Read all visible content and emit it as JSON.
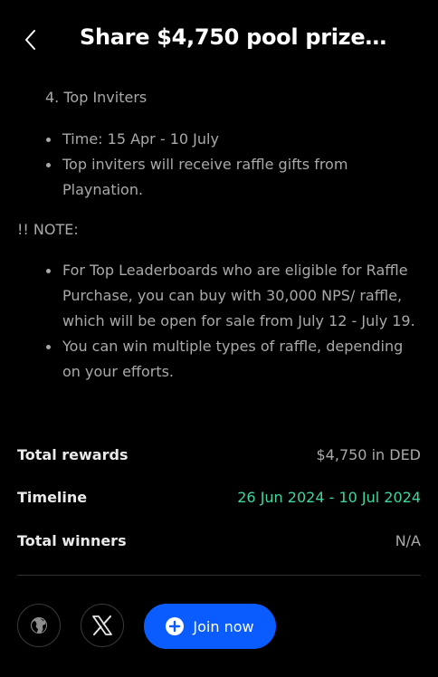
{
  "header": {
    "title": "Share $4,750 pool prize…",
    "back_icon": "chevron-left-icon"
  },
  "content": {
    "list_heading": "4. Top Inviters",
    "inviter_bullets": [
      "Time: 15 Apr - 10 July",
      "Top inviters will receive raffle gifts from Playnation."
    ],
    "note_label": "!! NOTE:",
    "note_bullets": [
      "For Top Leaderboards who are eligible for Raffle Purchase, you can buy with 30,000 NPS/ raffle, which will be open for sale from July 12 - July 19.",
      "You can win multiple types of raffle, depending on your efforts."
    ]
  },
  "stats": [
    {
      "label": "Total rewards",
      "value": "$4,750 in DED"
    },
    {
      "label": "Timeline",
      "value": "26 Jun 2024 - 10 Jul 2024"
    },
    {
      "label": "Total winners",
      "value": "N/A"
    }
  ],
  "colors": {
    "accent": "#0a5cff",
    "timeline": "#3dd6a0",
    "muted": "#a9a9a9"
  },
  "actions": {
    "website_icon": "globe-icon",
    "x_icon": "x-logo-icon",
    "join_icon": "plus-circle-icon",
    "join_label": "Join now"
  }
}
